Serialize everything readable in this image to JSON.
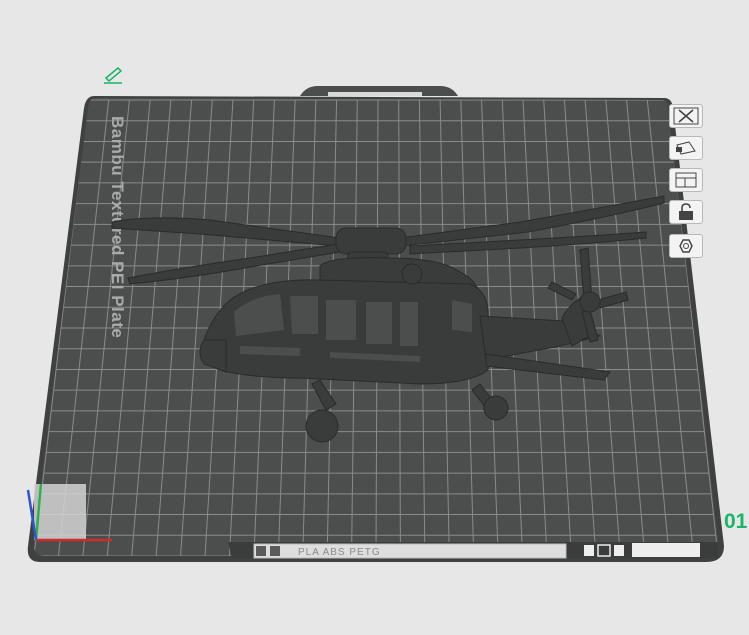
{
  "plate": {
    "texture_label": "Bambu Textured PEI Plate",
    "filament_compat": "PLA ABS PETG",
    "plate_number": "01"
  },
  "sidebar": {
    "buttons": [
      {
        "name": "close",
        "icon": "close-icon"
      },
      {
        "name": "arrange",
        "icon": "arrange-icon"
      },
      {
        "name": "layout",
        "icon": "layout-icon"
      },
      {
        "name": "lock",
        "icon": "lock-icon"
      },
      {
        "name": "settings",
        "icon": "settings-icon"
      }
    ]
  },
  "colors": {
    "background": "#e6e7e6",
    "plate": "#4c4d4d",
    "plate_edge": "#3a3b3b",
    "grid": "#8c8d8d",
    "model": "#3a3b3b",
    "accent_green": "#18b56a",
    "axis_x": "#d22b2b",
    "axis_y": "#2bb34a",
    "axis_z": "#2b55d2"
  }
}
